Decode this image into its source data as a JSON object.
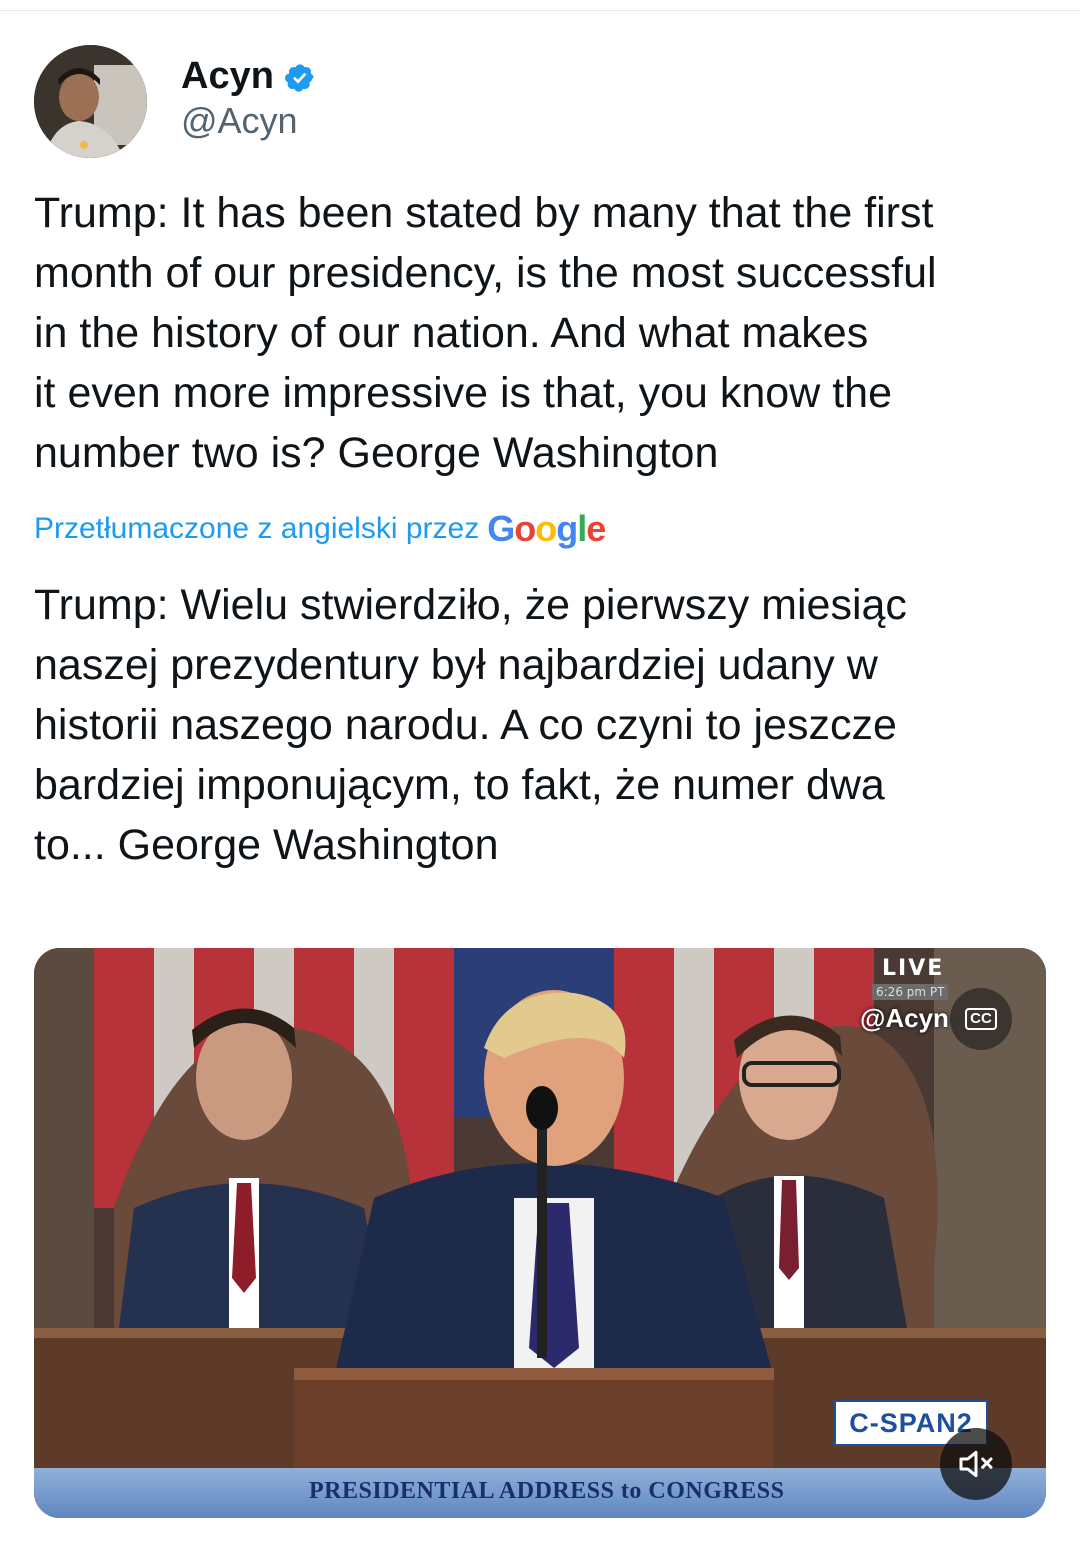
{
  "author": {
    "display_name": "Acyn",
    "handle": "@Acyn",
    "verified": true
  },
  "tweet": {
    "text_en": "Trump: It has been stated by many that the first\nmonth of our presidency, is the most successful\nin the history of our nation. And what makes\nit even more impressive is that, you know the\nnumber two is? George Washington",
    "translation_label": "Przetłumaczone z angielski przez",
    "translation_provider": "Google",
    "text_pl": "Trump: Wielu stwierdziło, że pierwszy miesiąc\nnaszej prezydentury był najbardziej udany w\nhistorii naszego narodu. A co czyni to jeszcze\nbardziej imponującym, to fakt, że numer dwa\nto... George Washington"
  },
  "media": {
    "type": "video",
    "live_label": "LIVE",
    "time_label": "6:26 pm PT",
    "watermark": "@Acyn",
    "cc_label": "CC",
    "network_logo": "C-SPAN2",
    "lower_third": "PRESIDENTIAL ADDRESS to CONGRESS",
    "muted": true
  },
  "icons": {
    "verified": "verified-badge-icon",
    "cc": "closed-captions-icon",
    "mute": "volume-muted-icon"
  },
  "colors": {
    "link_blue": "#1d9bf0",
    "handle_gray": "#536471",
    "text": "#0f1419"
  }
}
